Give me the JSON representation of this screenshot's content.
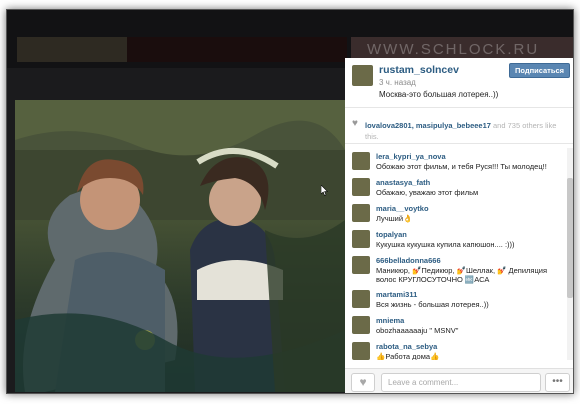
{
  "background": {
    "watermark": "WWW.SCHLOCK.RU"
  },
  "post": {
    "username": "rustam_solncev",
    "time": "3 ч. назад",
    "caption": "Москва-это большая лотерея..))",
    "follow_label": "Подписаться"
  },
  "likes": {
    "user1": "lovalova2801",
    "user2": "masipulya_bebeee17",
    "rest": " and 735 others like this."
  },
  "comments": [
    {
      "user": "lera_kypri_ya_nova",
      "text": "Обожаю этот фильм, и тебя Руся!!! Ты молодец!!"
    },
    {
      "user": "anastasya_fath",
      "text": "Обажаю, уважаю этот фильм"
    },
    {
      "user": "maria__voytko",
      "text": "Лучший👌"
    },
    {
      "user": "topalyan",
      "text": "Кукушка кукушка купила капюшон.... :)))"
    },
    {
      "user": "666belladonna666",
      "text": "Маникюр, 💅Педикюр, 💅Шеллак, 💅 Депиляция волос КРУГЛОСУТОЧНО 🔤АСА"
    },
    {
      "user": "martami311",
      "text": "Вся жизнь - большая лотерея..))"
    },
    {
      "user": "mniema",
      "text": "obozhaaaaaaju \" MSNV\""
    },
    {
      "user": "rabota_na_sebya",
      "text": "👍Работа дома👍"
    }
  ],
  "footer": {
    "comment_placeholder": "Leave a comment...",
    "more_label": "•••"
  },
  "colors": {
    "link": "#2c5c82",
    "follow_button": "#5a86b2"
  }
}
